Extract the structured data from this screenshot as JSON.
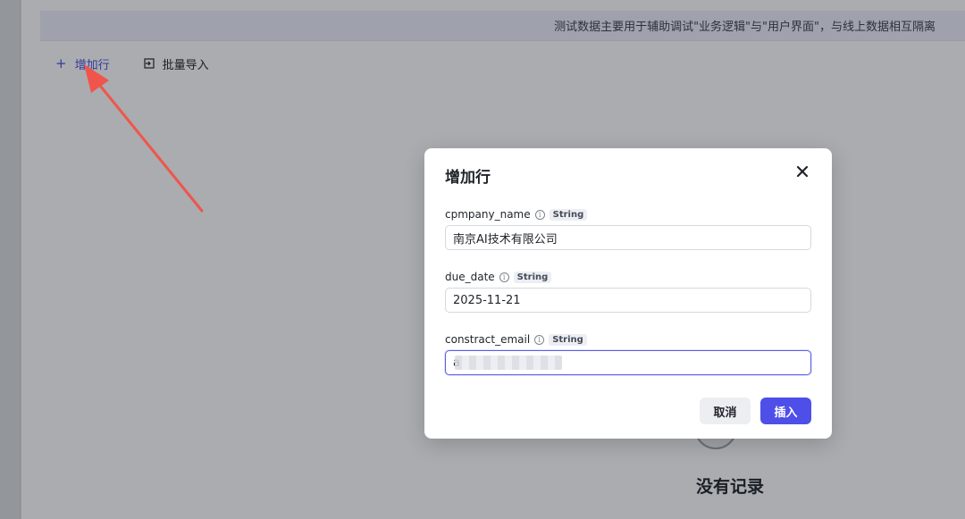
{
  "banner": {
    "text": "测试数据主要用于辅助调试\"业务逻辑\"与\"用户界面\"，与线上数据相互隔离"
  },
  "toolbar": {
    "add_row": {
      "icon": "plus-icon",
      "label": "增加行"
    },
    "bulk_import": {
      "icon": "import-icon",
      "label": "批量导入"
    }
  },
  "empty_state": {
    "text": "没有记录"
  },
  "modal": {
    "title": "增加行",
    "close_icon": "close-icon",
    "fields": [
      {
        "name": "cpmpany_name",
        "type": "String",
        "value": "南京AI技术有限公司"
      },
      {
        "name": "due_date",
        "type": "String",
        "value": "2025-11-21"
      },
      {
        "name": "constract_email",
        "type": "String",
        "value": "a"
      }
    ],
    "cancel_label": "取消",
    "insert_label": "插入"
  },
  "colors": {
    "accent": "#4e4fe8",
    "annotation_arrow": "#f0554c"
  }
}
